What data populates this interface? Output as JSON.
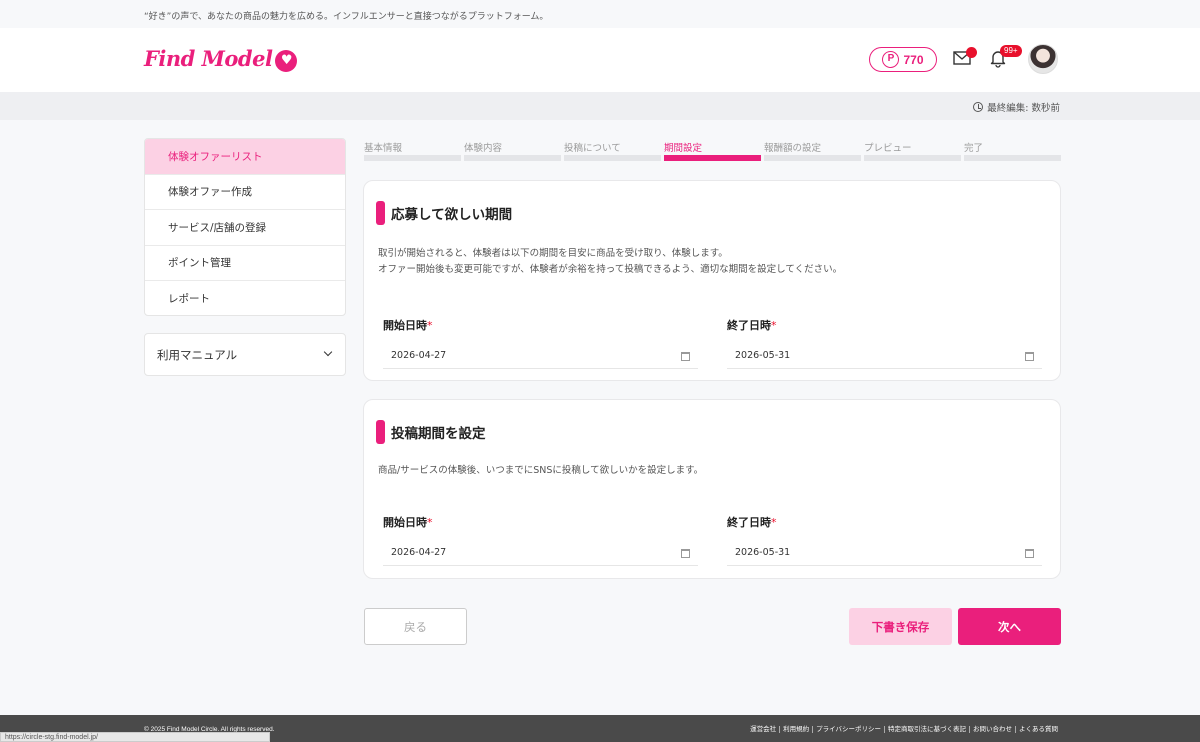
{
  "top": {
    "tagline": "“好き”の声で、あなたの商品の魅力を広める。インフルエンサーと直接つながるプラットフォーム。"
  },
  "header": {
    "logo_text": "Find Model",
    "points_label": "P",
    "points_value": "770",
    "notification_badge": "99+"
  },
  "edit": {
    "last_edited": "最終編集: 数秒前"
  },
  "sidebar": {
    "items": [
      {
        "label": "体験オファーリスト",
        "active": true
      },
      {
        "label": "体験オファー作成",
        "active": false
      },
      {
        "label": "サービス/店舗の登録",
        "active": false
      },
      {
        "label": "ポイント管理",
        "active": false
      },
      {
        "label": "レポート",
        "active": false
      }
    ],
    "manual_label": "利用マニュアル"
  },
  "steps": [
    {
      "label": "基本情報",
      "active": false
    },
    {
      "label": "体験内容",
      "active": false
    },
    {
      "label": "投稿について",
      "active": false
    },
    {
      "label": "期間設定",
      "active": true
    },
    {
      "label": "報酬額の設定",
      "active": false
    },
    {
      "label": "プレビュー",
      "active": false
    },
    {
      "label": "完了",
      "active": false
    }
  ],
  "section1": {
    "title": "応募して欲しい期間",
    "desc1": "取引が開始されると、体験者は以下の期間を目安に商品を受け取り、体験します。",
    "desc2": "オファー開始後も変更可能ですが、体験者が余裕を持って投稿できるよう、適切な期間を設定してください。",
    "start_label": "開始日時",
    "start_value": "2026-04-27",
    "end_label": "終了日時",
    "end_value": "2026-05-31"
  },
  "section2": {
    "title": "投稿期間を設定",
    "desc1": "商品/サービスの体験後、いつまでにSNSに投稿して欲しいかを設定します。",
    "start_label": "開始日時",
    "start_value": "2026-04-27",
    "end_label": "終了日時",
    "end_value": "2026-05-31"
  },
  "required_mark": "*",
  "buttons": {
    "back": "戻る",
    "draft": "下書き保存",
    "next": "次へ"
  },
  "footer": {
    "copyright": "© 2025 Find Model Circle. All rights reserved.",
    "links": [
      "運営会社",
      "利用規約",
      "プライバシーポリシー",
      "特定商取引法に基づく表記",
      "お問い合わせ",
      "よくある質問"
    ]
  },
  "status_bar_url": "https://circle-stg.find-model.jp/",
  "colors": {
    "accent": "#ea1f7c",
    "accent_light": "#fcd1e4",
    "badge_red": "#e8102c"
  }
}
